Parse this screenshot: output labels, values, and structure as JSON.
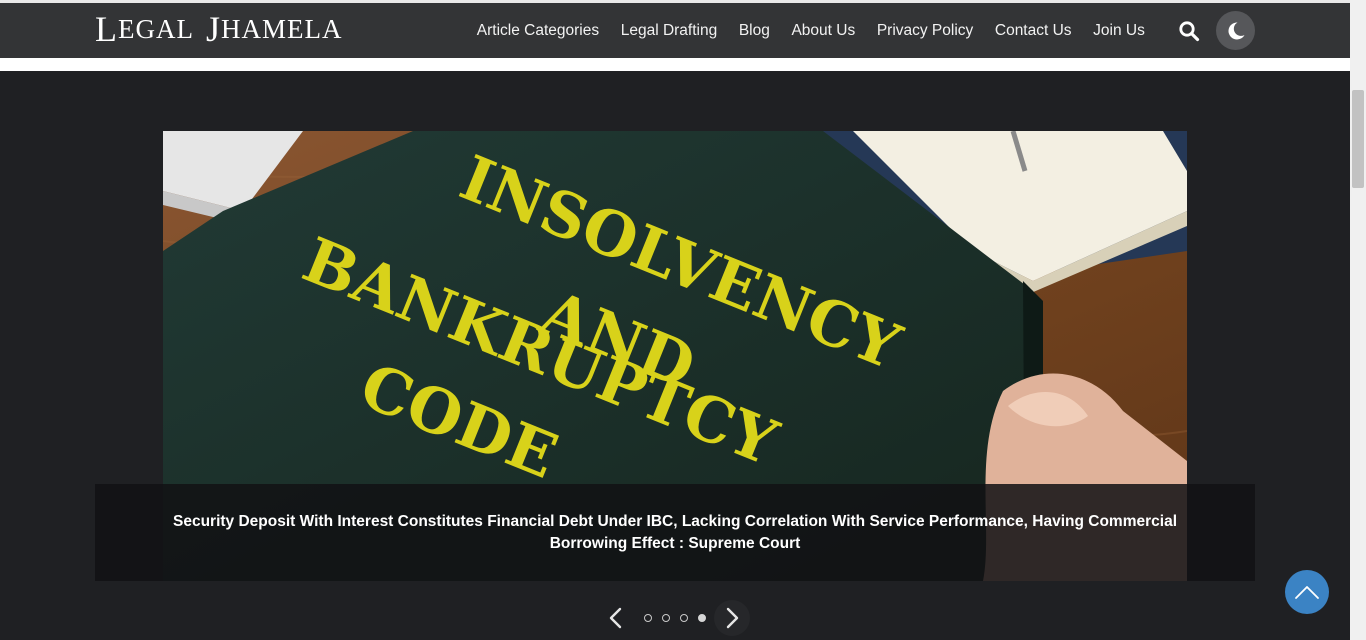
{
  "site": {
    "logo": {
      "word1_initial": "L",
      "word1_rest": "EGAL",
      "word2_initial": "J",
      "word2_rest": "HAMELA"
    }
  },
  "nav": {
    "items": [
      {
        "label": "Article Categories"
      },
      {
        "label": "Legal Drafting"
      },
      {
        "label": "Blog"
      },
      {
        "label": "About Us"
      },
      {
        "label": "Privacy Policy"
      },
      {
        "label": "Contact Us"
      },
      {
        "label": "Join Us"
      }
    ],
    "search_icon": "search-icon",
    "dark_mode_icon": "moon-icon"
  },
  "slider": {
    "image_text": {
      "line1": "INSOLVENCY",
      "line2": "AND",
      "line3": "BANKRUPTCY",
      "line4": "CODE"
    },
    "caption": "Security Deposit With Interest Constitutes Financial Debt Under IBC, Lacking Correlation With Service Performance, Having Commercial Borrowing Effect : Supreme Court",
    "slide_count": 4,
    "active_slide": 4,
    "prev_icon": "chevron-left-icon",
    "next_icon": "chevron-right-icon"
  },
  "back_to_top_icon": "chevron-up-icon",
  "colors": {
    "background": "#1f2023",
    "navbar": "#333436",
    "accent_blue": "#3b83c4",
    "book_text_yellow": "#d8d21a"
  }
}
